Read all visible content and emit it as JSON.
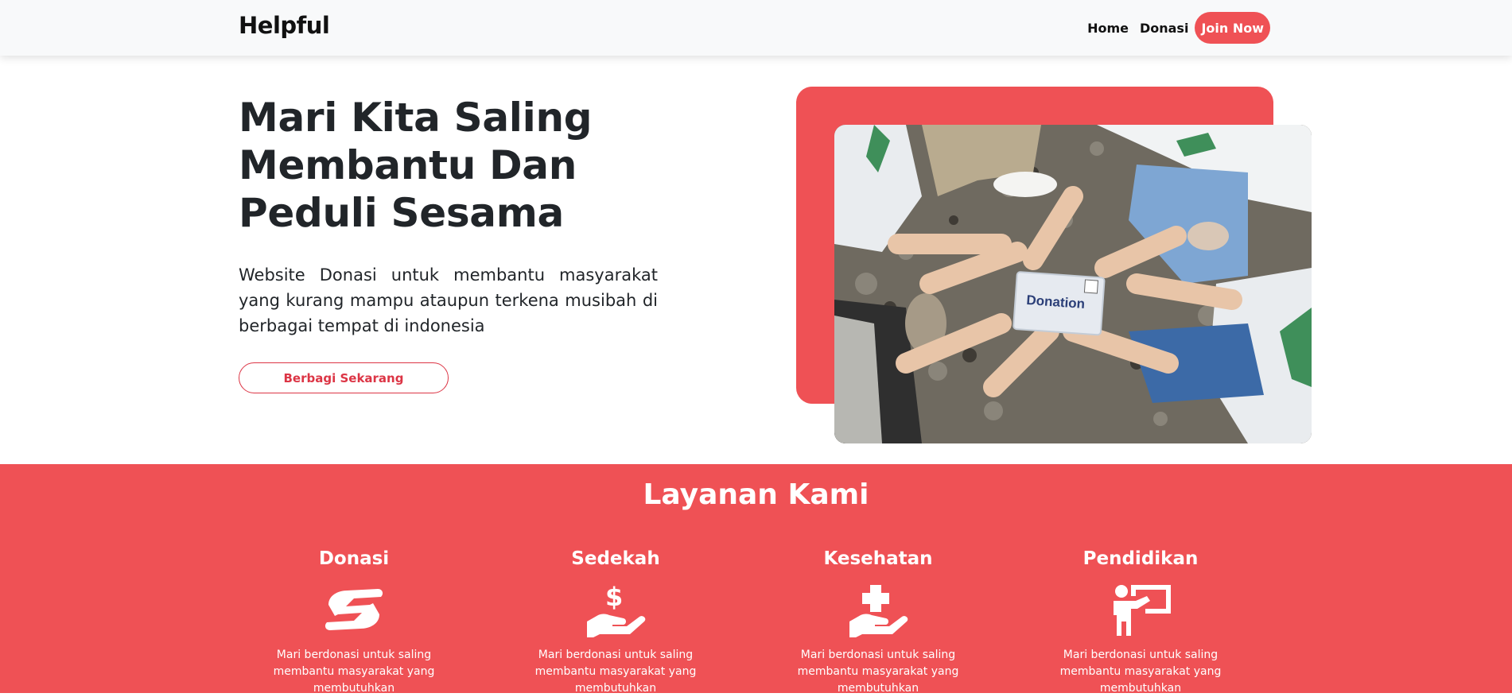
{
  "nav": {
    "brand": "Helpful",
    "links": [
      "Home",
      "Donasi"
    ],
    "join_label": "Join Now"
  },
  "hero": {
    "title": "Mari Kita Saling Membantu Dan Peduli Sesama",
    "description": "Website Donasi untuk membantu masyarakat yang kurang mampu ataupun terkena musibah di berbagai tempat di indonesia",
    "cta_label": "Berbagi Sekarang",
    "photo_sign_text": "Donation"
  },
  "services": {
    "title": "Layanan Kami",
    "items": [
      {
        "title": "Donasi",
        "icon": "hands-giving-icon",
        "desc": "Mari berdonasi untuk saling membantu masyarakat yang membutuhkan"
      },
      {
        "title": "Sedekah",
        "icon": "hand-holding-dollar-icon",
        "desc": "Mari berdonasi untuk saling membantu masyarakat yang membutuhkan"
      },
      {
        "title": "Kesehatan",
        "icon": "hand-holding-medical-icon",
        "desc": "Mari berdonasi untuk saling membantu masyarakat yang membutuhkan"
      },
      {
        "title": "Pendidikan",
        "icon": "chalkboard-teacher-icon",
        "desc": "Mari berdonasi untuk saling membantu masyarakat yang membutuhkan"
      }
    ]
  },
  "colors": {
    "accent": "#ef5155",
    "cta_border": "#dc3545",
    "navbar_bg": "#f8f9fa",
    "text_dark": "#212529"
  }
}
